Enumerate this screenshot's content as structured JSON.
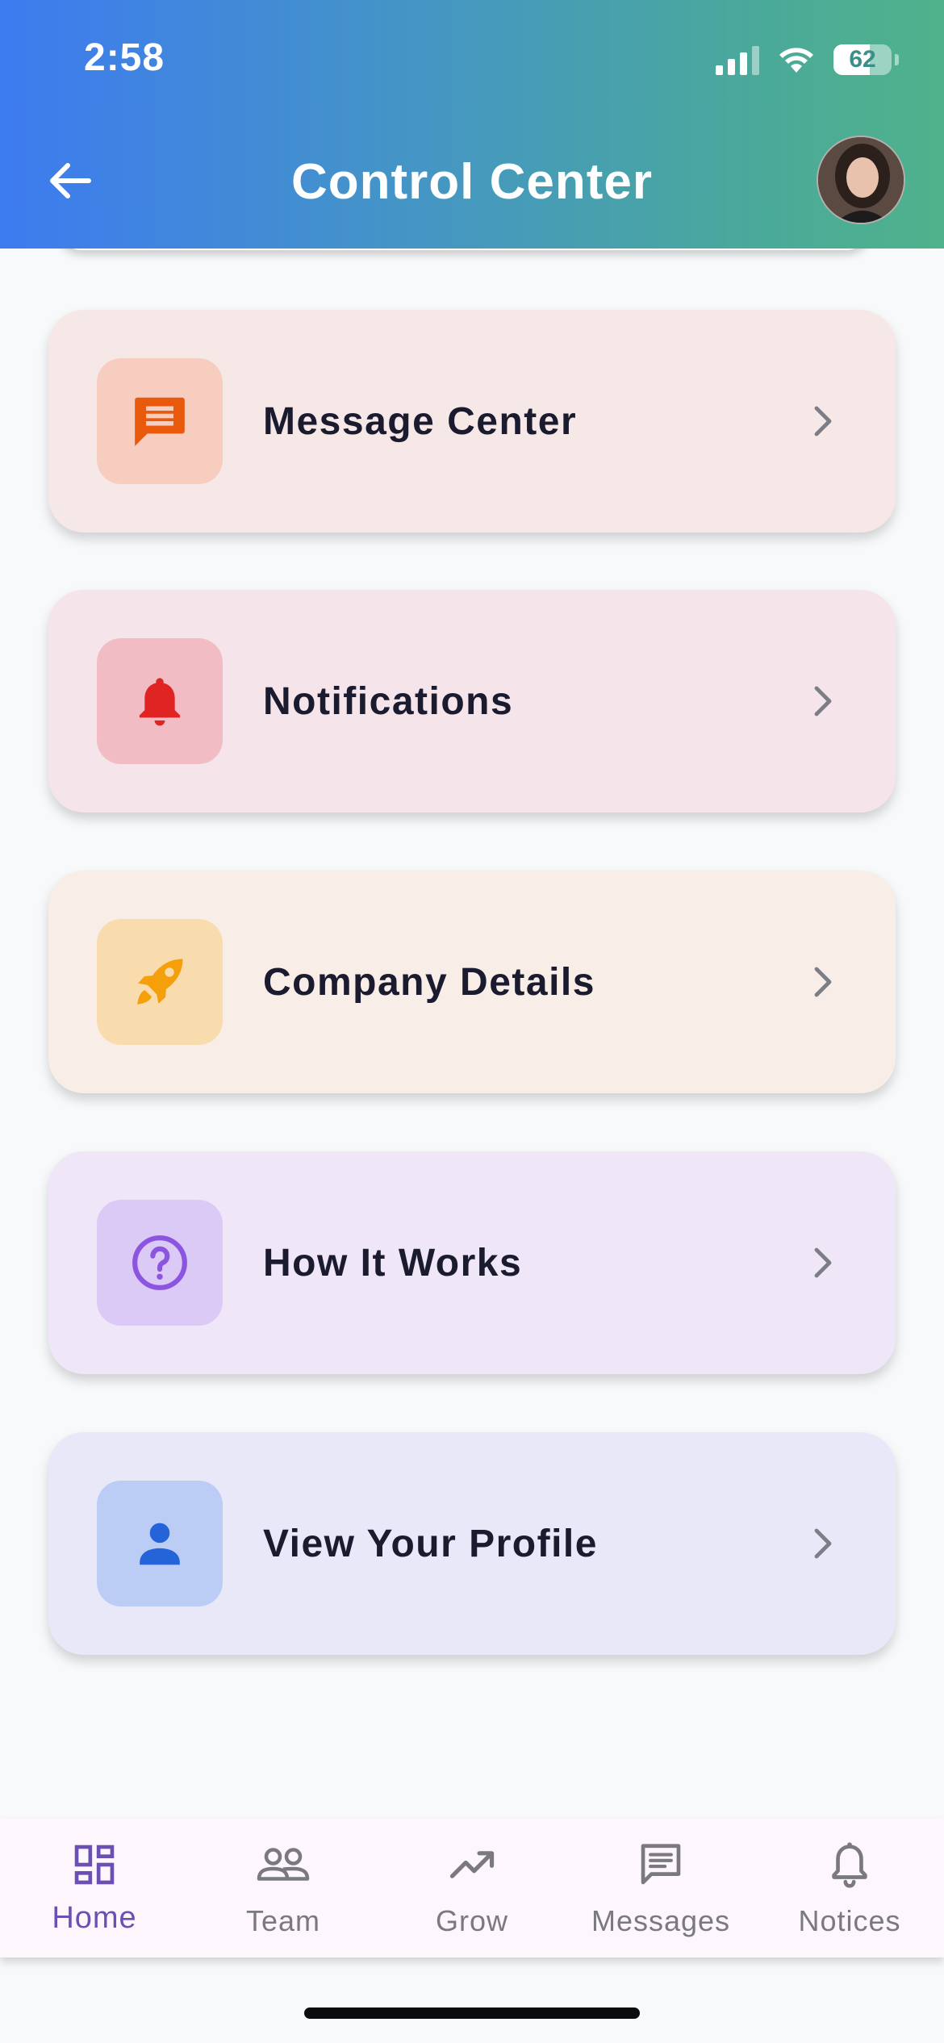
{
  "status_bar": {
    "time": "2:58",
    "battery": "62",
    "battery_level": 0.62
  },
  "header": {
    "title": "Control Center",
    "back_icon": "arrow-left-icon",
    "avatar": "user-avatar"
  },
  "colors": {
    "header_gradient_start": "#3d7bf0",
    "header_gradient_end": "#4fb28b",
    "nav_active": "#6b4fb3",
    "nav_inactive": "#7a7a7e"
  },
  "menu": {
    "items": [
      {
        "label": "Message Center",
        "icon": "message-icon",
        "bg": "#f7e8e8",
        "icon_bg": "#f6cdbf",
        "icon_color": "#e8590c"
      },
      {
        "label": "Notifications",
        "icon": "bell-icon",
        "bg": "#f5e4ea",
        "icon_bg": "#f1bcc4",
        "icon_color": "#e02424"
      },
      {
        "label": "Company Details",
        "icon": "rocket-icon",
        "bg": "#f8ede7",
        "icon_bg": "#f8dcae",
        "icon_color": "#f59f0a"
      },
      {
        "label": "How It Works",
        "icon": "help-circle-icon",
        "bg": "#efe6f7",
        "icon_bg": "#dccaf6",
        "icon_color": "#8b55e0"
      },
      {
        "label": "View Your Profile",
        "icon": "person-icon",
        "bg": "#e8e8f8",
        "icon_bg": "#bccdf5",
        "icon_color": "#2563d8"
      }
    ]
  },
  "bottom_nav": {
    "items": [
      {
        "label": "Home",
        "icon": "dashboard-icon",
        "active": true
      },
      {
        "label": "Team",
        "icon": "team-icon",
        "active": false
      },
      {
        "label": "Grow",
        "icon": "trending-up-icon",
        "active": false
      },
      {
        "label": "Messages",
        "icon": "chat-icon",
        "active": false
      },
      {
        "label": "Notices",
        "icon": "bell-outline-icon",
        "active": false
      }
    ]
  }
}
